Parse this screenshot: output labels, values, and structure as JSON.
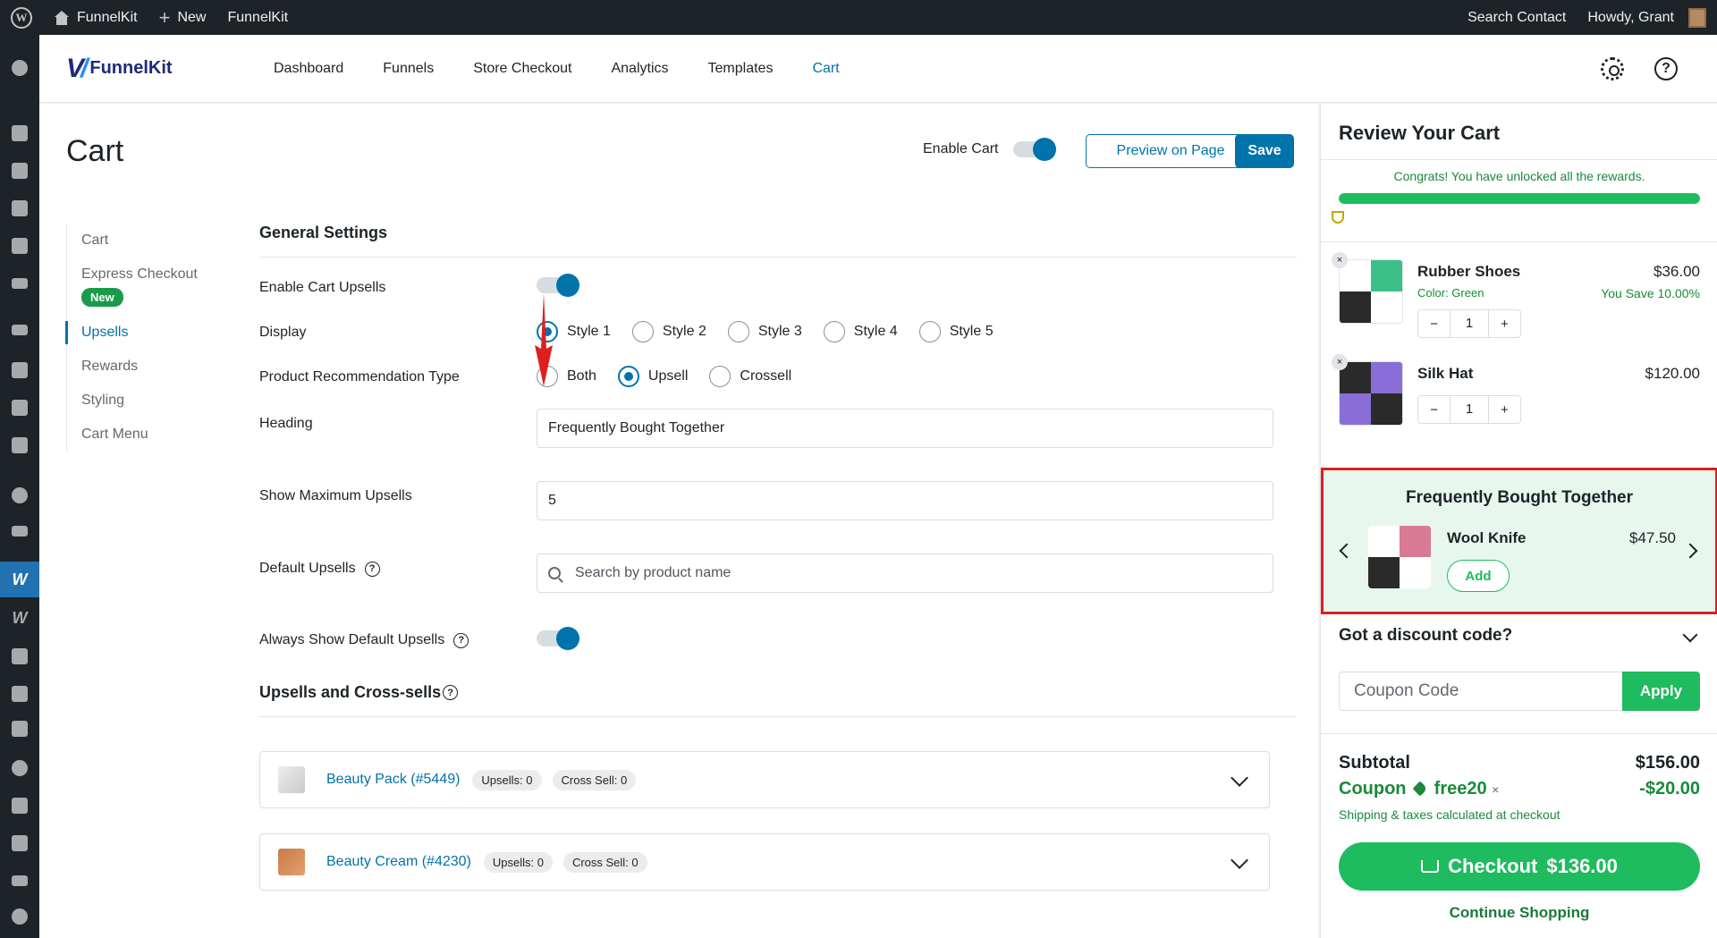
{
  "adminbar": {
    "site_name": "FunnelKit",
    "new_label": "New",
    "plugin_name": "FunnelKit",
    "search_contact": "Search Contact",
    "howdy": "Howdy, Grant"
  },
  "header": {
    "brand": "FunnelKit",
    "tabs": [
      "Dashboard",
      "Funnels",
      "Store Checkout",
      "Analytics",
      "Templates",
      "Cart"
    ],
    "active_tab": "Cart"
  },
  "page": {
    "title": "Cart",
    "enable_cart_label": "Enable Cart",
    "preview_label": "Preview on Page",
    "save_label": "Save"
  },
  "subnav": {
    "items": [
      "Cart",
      "Express Checkout",
      "Upsells",
      "Rewards",
      "Styling",
      "Cart Menu"
    ],
    "new_badge": "New",
    "active": "Upsells"
  },
  "settings": {
    "section_title": "General Settings",
    "enable_upsells_label": "Enable Cart Upsells",
    "display_label": "Display",
    "display_options": [
      "Style 1",
      "Style 2",
      "Style 3",
      "Style 4",
      "Style 5"
    ],
    "display_selected": "Style 1",
    "rec_type_label": "Product Recommendation Type",
    "rec_type_options": [
      "Both",
      "Upsell",
      "Crossell"
    ],
    "rec_type_selected": "Upsell",
    "heading_label": "Heading",
    "heading_value": "Frequently Bought Together",
    "max_upsells_label": "Show Maximum Upsells",
    "max_upsells_value": "5",
    "default_upsells_label": "Default Upsells",
    "default_upsells_placeholder": "Search by product name",
    "always_show_label": "Always Show Default Upsells",
    "upsells_section_title": "Upsells and Cross-sells",
    "products": [
      {
        "name": "Beauty Pack (#5449)",
        "upsells": "Upsells: 0",
        "cross_sell": "Cross Sell: 0"
      },
      {
        "name": "Beauty Cream (#4230)",
        "upsells": "Upsells: 0",
        "cross_sell": "Cross Sell: 0"
      }
    ]
  },
  "cart": {
    "title": "Review Your Cart",
    "congrats": "Congrats! You have unlocked all the rewards.",
    "progress_percent": 100,
    "items": [
      {
        "name": "Rubber Shoes",
        "price": "$36.00",
        "variant": "Color: Green",
        "saving": "You Save 10.00%",
        "qty": "1"
      },
      {
        "name": "Silk Hat",
        "price": "$120.00",
        "variant": "",
        "saving": "",
        "qty": "1"
      }
    ],
    "fbt": {
      "title": "Frequently Bought Together",
      "product_name": "Wool Knife",
      "product_price": "$47.50",
      "add_label": "Add"
    },
    "discount_title": "Got a discount code?",
    "coupon_placeholder": "Coupon Code",
    "apply_label": "Apply",
    "subtotal_label": "Subtotal",
    "subtotal_value": "$156.00",
    "coupon_label": "Coupon",
    "coupon_code": "free20",
    "coupon_value": "-$20.00",
    "shipping_note": "Shipping & taxes calculated at checkout",
    "checkout_label": "Checkout",
    "checkout_total": "$136.00",
    "continue_label": "Continue Shopping"
  },
  "colors": {
    "wp_blue": "#0073aa",
    "cart_green": "#1fbb5f",
    "highlight_red": "#e01e1e"
  }
}
